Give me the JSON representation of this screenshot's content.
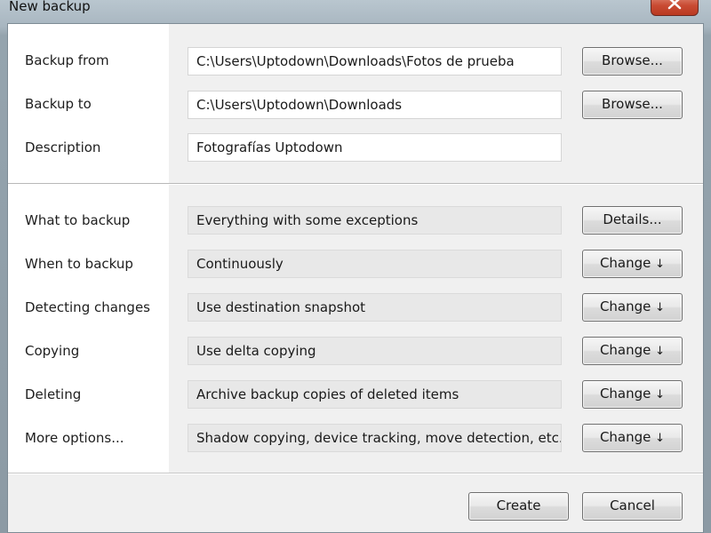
{
  "window": {
    "title": "New backup"
  },
  "source": {
    "label": "Backup from",
    "value": "C:\\Users\\Uptodown\\Downloads\\Fotos de prueba",
    "button": "Browse..."
  },
  "destination": {
    "label": "Backup to",
    "value": "C:\\Users\\Uptodown\\Downloads",
    "button": "Browse..."
  },
  "description": {
    "label": "Description",
    "value": "Fotografías Uptodown"
  },
  "settings": [
    {
      "label": "What to backup",
      "value": "Everything with some exceptions",
      "button": "Details...",
      "arrow": ""
    },
    {
      "label": "When to backup",
      "value": "Continuously",
      "button": "Change",
      "arrow": "↓"
    },
    {
      "label": "Detecting changes",
      "value": "Use destination snapshot",
      "button": "Change",
      "arrow": "↓"
    },
    {
      "label": "Copying",
      "value": "Use delta copying",
      "button": "Change",
      "arrow": "↓"
    },
    {
      "label": "Deleting",
      "value": "Archive backup copies of deleted items",
      "button": "Change",
      "arrow": "↓"
    },
    {
      "label": "More options...",
      "value": "Shadow copying, device tracking, move detection, etc.",
      "button": "Change",
      "arrow": "↓"
    }
  ],
  "footer": {
    "create": "Create",
    "cancel": "Cancel"
  }
}
